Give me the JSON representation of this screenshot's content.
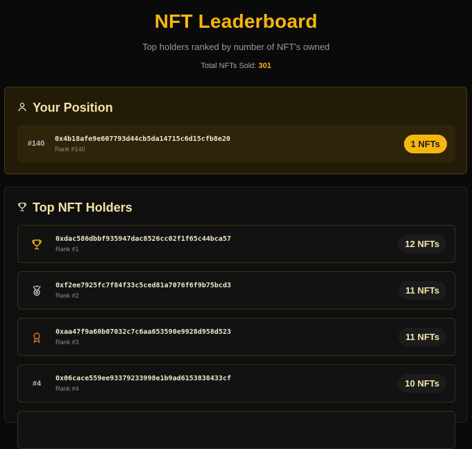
{
  "header": {
    "title": "NFT Leaderboard",
    "subtitle": "Top holders ranked by number of NFT's owned",
    "total_label": "Total NFTs Sold:",
    "total_value": "301"
  },
  "your_position": {
    "title": "Your Position",
    "rank_label": "#140",
    "address": "0x4b18afe9e607793d44cb5da14715c6d15cfb8e20",
    "rank_text": "Rank #140",
    "nfts": "1 NFTs"
  },
  "top_holders": {
    "title": "Top NFT Holders",
    "rows": [
      {
        "icon": "trophy-icon",
        "rank_label": "",
        "address": "0xdac586dbbf935947dac8526cc02f1f65c44bca57",
        "rank_text": "Rank #1",
        "nfts": "12 NFTs"
      },
      {
        "icon": "medal-icon",
        "rank_label": "",
        "address": "0xf2ee7925fc7f84f33c5ced81a7076f6f9b75bcd3",
        "rank_text": "Rank #2",
        "nfts": "11 NFTs"
      },
      {
        "icon": "award-icon",
        "rank_label": "",
        "address": "0xaa47f9a60b07032c7c6aa653590e9928d958d523",
        "rank_text": "Rank #3",
        "nfts": "11 NFTs"
      },
      {
        "icon": "",
        "rank_label": "#4",
        "address": "0x06cace559ee93379233998e1b9ad6153838433cf",
        "rank_text": "Rank #4",
        "nfts": "10 NFTs"
      }
    ]
  },
  "colors": {
    "accent": "#f5b60f",
    "background": "#0a0a0a",
    "silver": "#b9c4d0",
    "bronze": "#d9772b"
  }
}
